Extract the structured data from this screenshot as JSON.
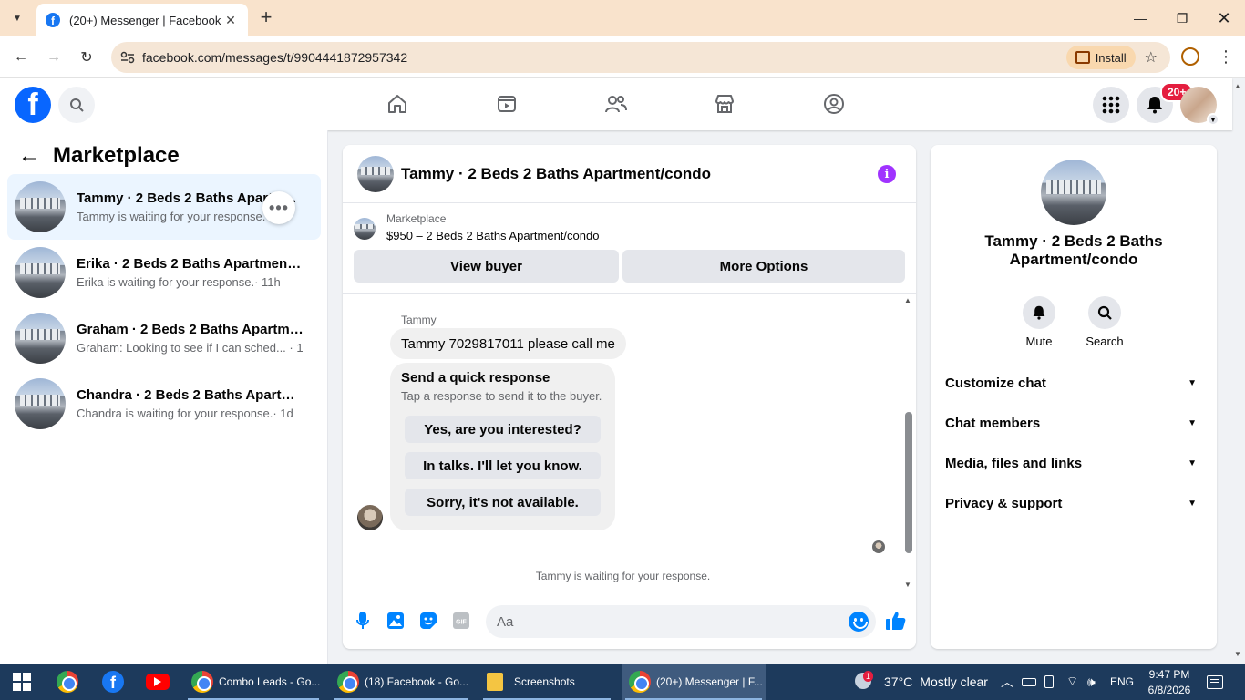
{
  "browser": {
    "tab_title": "(20+) Messenger | Facebook",
    "url": "facebook.com/messages/t/9904441872957342",
    "install_label": "Install"
  },
  "header": {
    "notification_badge": "20+"
  },
  "left": {
    "title": "Marketplace",
    "conversations": [
      {
        "name": "Tammy · 2 Beds 2 Baths Apartm...",
        "preview": "Tammy is waiting for your response.",
        "time": ""
      },
      {
        "name": "Erika · 2 Beds 2 Baths Apartment/c...",
        "preview": "Erika is waiting for your response.",
        "time": "· 11h"
      },
      {
        "name": "Graham · 2 Beds 2 Baths Apartme...",
        "preview": "Graham: Looking to see if I can sched...",
        "time": "· 1d"
      },
      {
        "name": "Chandra · 2 Beds 2 Baths Apartme...",
        "preview": "Chandra is waiting for your response.",
        "time": "· 1d"
      }
    ]
  },
  "chat": {
    "title": "Tammy · 2 Beds 2 Baths Apartment/condo",
    "marketplace_label": "Marketplace",
    "listing": "$950 – 2 Beds 2 Baths Apartment/condo",
    "view_buyer": "View buyer",
    "more_options": "More Options",
    "sender": "Tammy",
    "message": "Tammy 7029817011 please call me",
    "quick_title": "Send a quick response",
    "quick_sub": "Tap a response to send it to the buyer.",
    "quick_options": [
      "Yes, are you interested?",
      "In talks. I'll let you know.",
      "Sorry, it's not available."
    ],
    "waiting": "Tammy is waiting for your response.",
    "input_placeholder": "Aa"
  },
  "info": {
    "name": "Tammy · 2 Beds 2 Baths Apartment/condo",
    "mute": "Mute",
    "search": "Search",
    "sections": [
      "Customize chat",
      "Chat members",
      "Media, files and links",
      "Privacy & support"
    ]
  },
  "taskbar": {
    "apps": [
      "Combo Leads - Go...",
      "(18) Facebook - Go...",
      "Screenshots",
      "(20+) Messenger | F..."
    ],
    "weather_temp": "37°C",
    "weather_desc": "Mostly clear",
    "weather_badge": "1",
    "lang": "ENG",
    "time": "9:47 PM",
    "date": "6/8/2026"
  },
  "colors": {
    "fb_blue": "#0866ff",
    "accent_purple": "#a033ff",
    "active_row": "#ebf5ff",
    "taskbar": "#1d3a5c"
  }
}
